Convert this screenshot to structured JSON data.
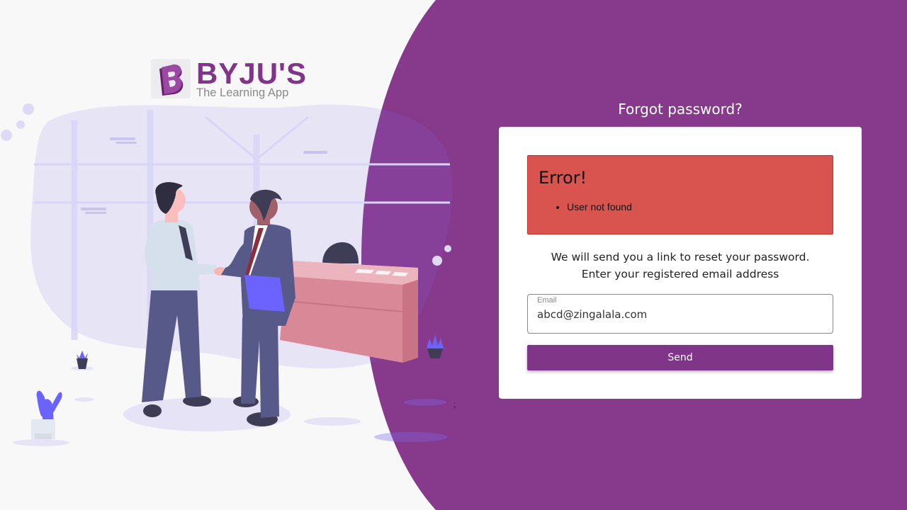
{
  "brand": {
    "name": "BYJU'S",
    "tagline": "The Learning App",
    "mark": "B",
    "accent_color": "#813588"
  },
  "page": {
    "title": "Forgot password?"
  },
  "error": {
    "title": "Error!",
    "messages": [
      "User not found"
    ],
    "color": "#d9534f"
  },
  "info": {
    "line1": "We will send you a link to reset your password.",
    "line2": "Enter your registered email address"
  },
  "email": {
    "label": "Email",
    "value": "abcd@zingalala.com"
  },
  "send_label": "Send",
  "stray_text": ";"
}
